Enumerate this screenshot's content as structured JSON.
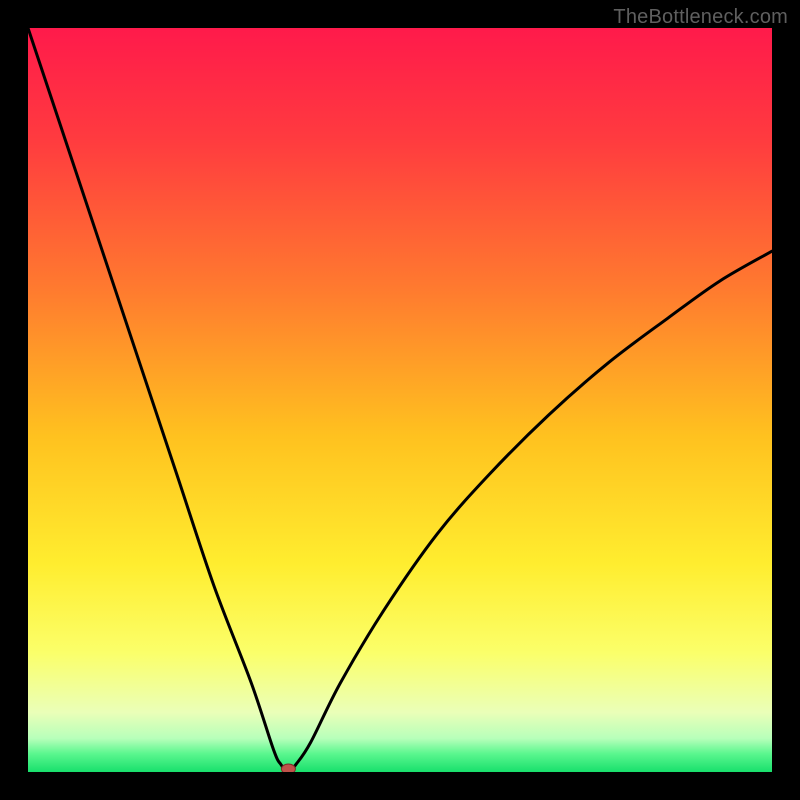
{
  "watermark": "TheBottleneck.com",
  "chart_data": {
    "type": "line",
    "title": "",
    "xlabel": "",
    "ylabel": "",
    "xlim": [
      0,
      100
    ],
    "ylim": [
      0,
      100
    ],
    "series": [
      {
        "name": "bottleneck-curve",
        "x": [
          0,
          5,
          10,
          15,
          20,
          25,
          30,
          33,
          34,
          35,
          36,
          38,
          42,
          48,
          55,
          62,
          70,
          78,
          86,
          93,
          100
        ],
        "values": [
          100,
          85,
          70,
          55,
          40,
          25,
          12,
          3,
          1,
          0,
          1,
          4,
          12,
          22,
          32,
          40,
          48,
          55,
          61,
          66,
          70
        ]
      }
    ],
    "marker": {
      "x": 35,
      "y": 0
    },
    "gradient_stops": [
      {
        "offset": 0.0,
        "color": "#ff1a4b"
      },
      {
        "offset": 0.15,
        "color": "#ff3b3f"
      },
      {
        "offset": 0.35,
        "color": "#ff7a2f"
      },
      {
        "offset": 0.55,
        "color": "#ffc21f"
      },
      {
        "offset": 0.72,
        "color": "#ffed2f"
      },
      {
        "offset": 0.84,
        "color": "#fbff6a"
      },
      {
        "offset": 0.92,
        "color": "#eaffb8"
      },
      {
        "offset": 0.955,
        "color": "#b7ffba"
      },
      {
        "offset": 0.975,
        "color": "#5cf78f"
      },
      {
        "offset": 1.0,
        "color": "#18e06c"
      }
    ]
  }
}
